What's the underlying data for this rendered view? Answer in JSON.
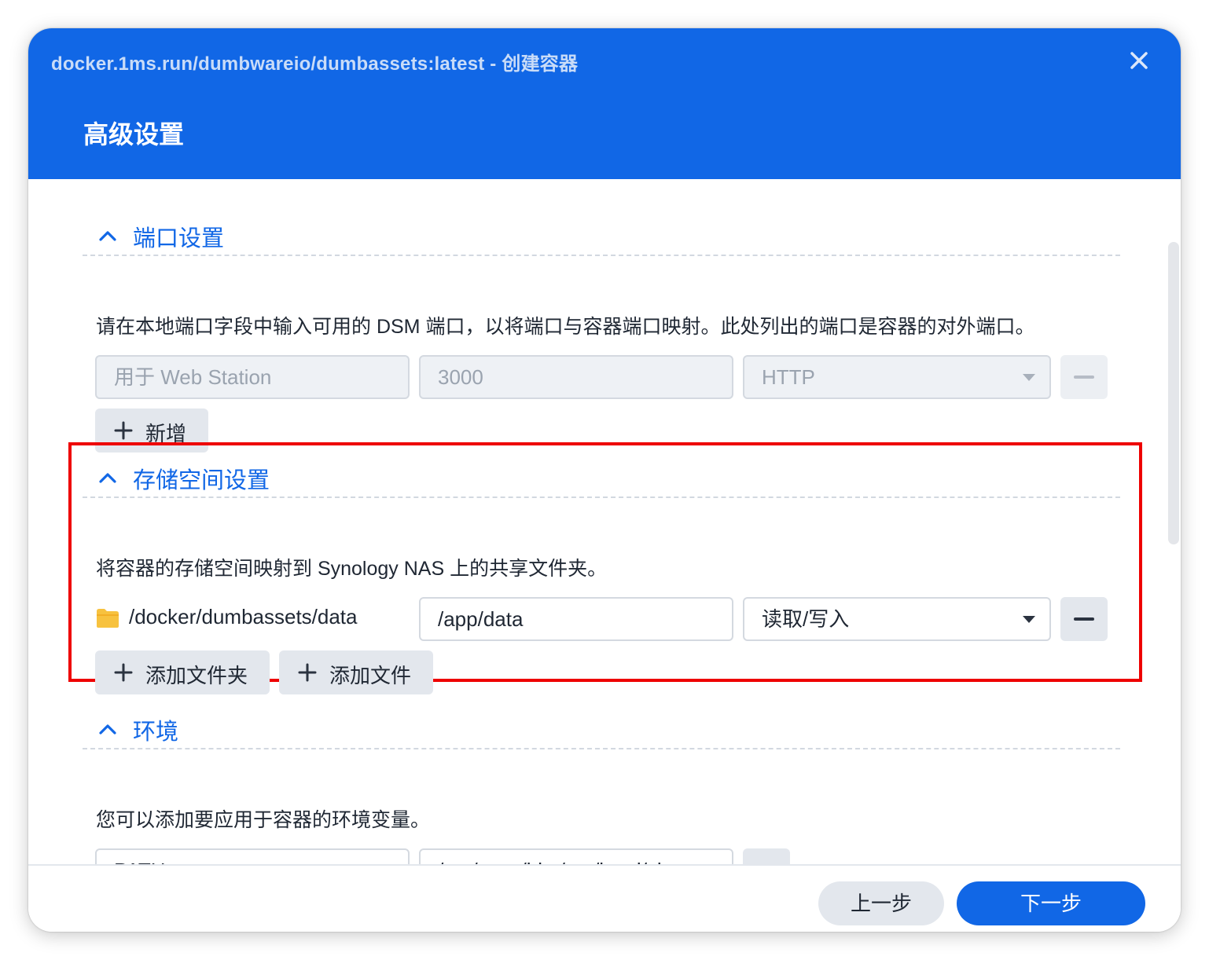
{
  "window": {
    "title": "docker.1ms.run/dumbwareio/dumbassets:latest - 创建容器",
    "close_icon": "close-icon"
  },
  "page": {
    "title": "高级设置"
  },
  "ports": {
    "title": "端口设置",
    "description": "请在本地端口字段中输入可用的 DSM 端口，以将端口与容器端口映射。此处列出的端口是容器的对外端口。",
    "rows": [
      {
        "local_port": "用于 Web Station",
        "container_port": "3000",
        "protocol": "HTTP"
      }
    ],
    "add_label": "新增"
  },
  "storage": {
    "title": "存储空间设置",
    "description": "将容器的存储空间映射到 Synology NAS 上的共享文件夹。",
    "rows": [
      {
        "folder": "/docker/dumbassets/data",
        "mount_path": "/app/data",
        "permission": "读取/写入"
      }
    ],
    "add_folder_label": "添加文件夹",
    "add_file_label": "添加文件"
  },
  "environment": {
    "title": "环境",
    "description": "您可以添加要应用于容器的环境变量。",
    "rows": [
      {
        "name": "PATH",
        "value": "/opt/venv/bin:/usr/local/sb"
      }
    ]
  },
  "footer": {
    "prev_label": "上一步",
    "next_label": "下一步"
  },
  "colors": {
    "accent": "#1167e6",
    "highlight": "#ee0000",
    "folder": "#f7c23f"
  }
}
